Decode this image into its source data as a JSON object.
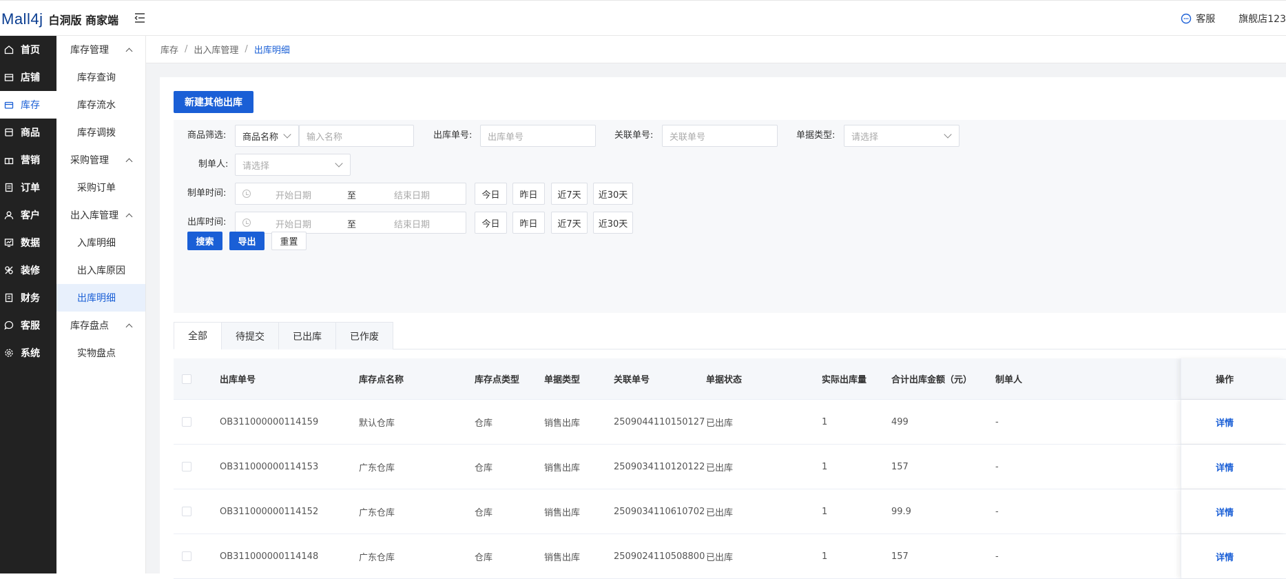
{
  "header": {
    "logo_mark": "Mall4j",
    "logo_text": "白洞版 商家端",
    "kefu": "客服",
    "shop_name": "旗舰店123"
  },
  "sidebar": {
    "items": [
      {
        "label": "首页",
        "icon": "home-icon"
      },
      {
        "label": "店铺",
        "icon": "store-icon"
      },
      {
        "label": "库存",
        "icon": "inventory-icon",
        "active": true
      },
      {
        "label": "商品",
        "icon": "product-icon"
      },
      {
        "label": "营销",
        "icon": "gift-icon"
      },
      {
        "label": "订单",
        "icon": "order-icon"
      },
      {
        "label": "客户",
        "icon": "user-icon"
      },
      {
        "label": "数据",
        "icon": "chart-icon"
      },
      {
        "label": "装修",
        "icon": "palette-icon"
      },
      {
        "label": "财务",
        "icon": "finance-icon"
      },
      {
        "label": "客服",
        "icon": "chat-icon"
      },
      {
        "label": "系统",
        "icon": "gear-icon"
      }
    ]
  },
  "subnav": {
    "group1": "库存管理",
    "item1": "库存查询",
    "item2": "库存流水",
    "item3": "库存调拨",
    "group2": "采购管理",
    "item4": "采购订单",
    "group3": "出入库管理",
    "item5": "入库明细",
    "item6": "出入库原因",
    "item7": "出库明细",
    "group4": "库存盘点",
    "item8": "实物盘点"
  },
  "breadcrumb": {
    "l1": "库存",
    "l2": "出入库管理",
    "l3": "出库明细",
    "sep": "/"
  },
  "actions": {
    "new_out": "新建其他出库"
  },
  "filter": {
    "product_label": "商品筛选:",
    "product_type": "商品名称",
    "product_placeholder": "输入名称",
    "outno_label": "出库单号:",
    "outno_placeholder": "出库单号",
    "relno_label": "关联单号:",
    "relno_placeholder": "关联单号",
    "doctype_label": "单据类型:",
    "doctype_placeholder": "请选择",
    "maker_label": "制单人:",
    "maker_placeholder": "请选择",
    "create_time_label": "制单时间:",
    "out_time_label": "出库时间:",
    "start_date": "开始日期",
    "to": "至",
    "end_date": "结束日期",
    "today": "今日",
    "yesterday": "昨日",
    "last7": "近7天",
    "last30": "近30天",
    "search": "搜索",
    "export": "导出",
    "reset": "重置"
  },
  "tabs": [
    "全部",
    "待提交",
    "已出库",
    "已作废"
  ],
  "table": {
    "headers": {
      "out_no": "出库单号",
      "warehouse": "库存点名称",
      "wh_type": "库存点类型",
      "doc_type": "单据类型",
      "rel_no": "关联单号",
      "status": "单据状态",
      "qty": "实际出库量",
      "amount": "合计出库金额（元）",
      "maker": "制单人",
      "op": "操作"
    },
    "rows": [
      {
        "out_no": "OB311000000114159",
        "warehouse": "默认仓库",
        "wh_type": "仓库",
        "doc_type": "销售出库",
        "rel_no": "2509044110150127",
        "status": "已出库",
        "qty": "1",
        "amount": "499",
        "maker": "-",
        "op": "详情"
      },
      {
        "out_no": "OB311000000114153",
        "warehouse": "广东仓库",
        "wh_type": "仓库",
        "doc_type": "销售出库",
        "rel_no": "2509034110120122",
        "status": "已出库",
        "qty": "1",
        "amount": "157",
        "maker": "-",
        "op": "详情"
      },
      {
        "out_no": "OB311000000114152",
        "warehouse": "广东仓库",
        "wh_type": "仓库",
        "doc_type": "销售出库",
        "rel_no": "2509034110610702",
        "status": "已出库",
        "qty": "1",
        "amount": "99.9",
        "maker": "-",
        "op": "详情"
      },
      {
        "out_no": "OB311000000114148",
        "warehouse": "广东仓库",
        "wh_type": "仓库",
        "doc_type": "销售出库",
        "rel_no": "2509024110508800",
        "status": "已出库",
        "qty": "1",
        "amount": "157",
        "maker": "-",
        "op": "详情"
      }
    ]
  },
  "colors": {
    "primary": "#1a5fd6",
    "sidebar_bg": "#222222",
    "page_bg": "#f2f3f5"
  }
}
